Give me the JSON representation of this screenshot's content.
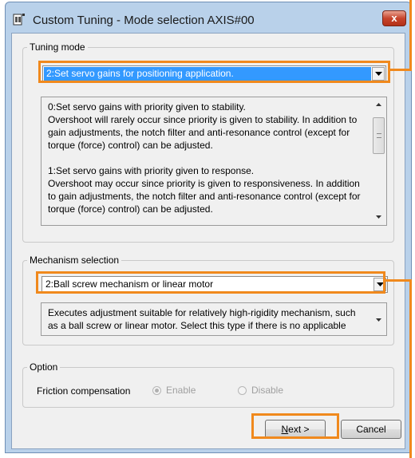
{
  "window": {
    "title": "Custom Tuning - Mode selection AXIS#00",
    "close_label": "x"
  },
  "tuning_mode": {
    "legend": "Tuning mode",
    "selected": "2:Set servo gains for positioning application.",
    "description": [
      "0:Set servo gains with priority given to stability.\nOvershoot will rarely occur since priority is given to stability. In addition to gain adjustments, the notch filter and anti-resonance control (except for torque (force) control) can be adjusted.",
      "1:Set servo gains with priority given to response.\nOvershoot may occur since priority is given to responsiveness. In addition to gain adjustments, the notch filter and anti-resonance control (except for torque (force) control) can be adjusted."
    ]
  },
  "mechanism": {
    "legend": "Mechanism selection",
    "selected": "2:Ball screw mechanism or linear motor",
    "description": "Executes adjustment suitable for relatively high-rigidity mechanism, such as a ball screw or linear motor. Select this type if there is no applicable"
  },
  "option": {
    "legend": "Option",
    "friction_label": "Friction compensation",
    "enable_label": "Enable",
    "disable_label": "Disable",
    "selected": "Enable"
  },
  "buttons": {
    "next_label": "Next >",
    "cancel_label": "Cancel"
  },
  "colors": {
    "callout": "#f0891d",
    "selection": "#3399ff",
    "title_bar": "#b9d1ea"
  }
}
